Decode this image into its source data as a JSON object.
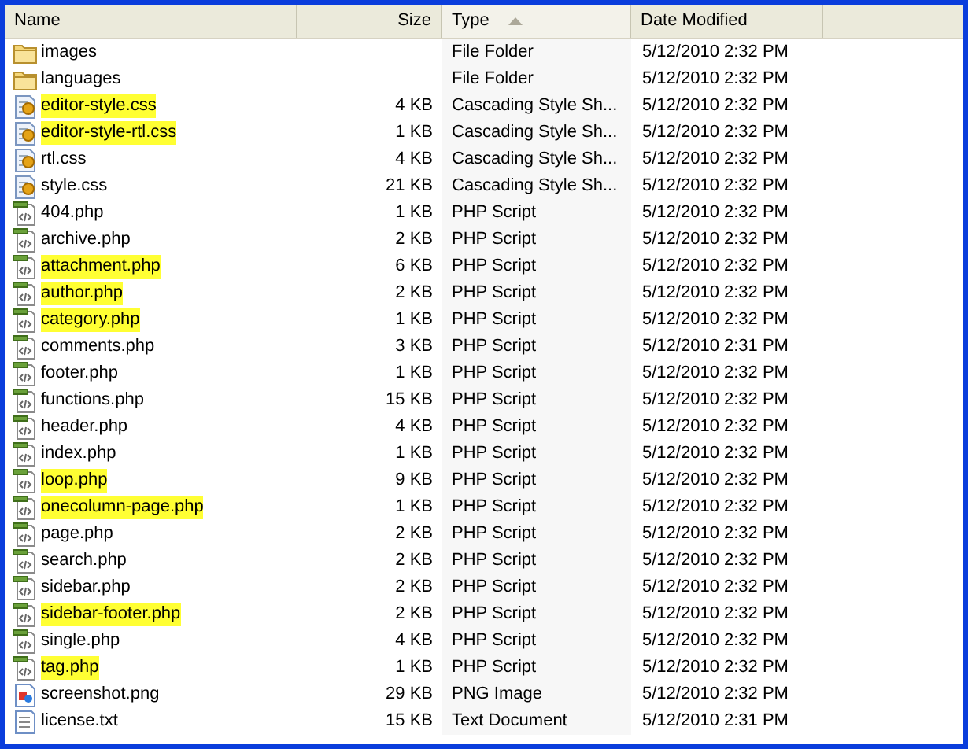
{
  "columns": [
    {
      "label": "Name",
      "sorted": false
    },
    {
      "label": "Size",
      "sorted": false
    },
    {
      "label": "Type",
      "sorted": true
    },
    {
      "label": "Date Modified",
      "sorted": false
    }
  ],
  "files": [
    {
      "kind": "folder",
      "name": "images",
      "type": "File Folder",
      "modified": "5/12/2010 2:32 PM",
      "highlighted": false
    },
    {
      "kind": "folder",
      "name": "languages",
      "type": "File Folder",
      "modified": "5/12/2010 2:32 PM",
      "highlighted": false
    },
    {
      "kind": "css",
      "name": "editor-style.css",
      "size": "4 KB",
      "type": "Cascading Style Sh...",
      "modified": "5/12/2010 2:32 PM",
      "highlighted": true
    },
    {
      "kind": "css",
      "name": "editor-style-rtl.css",
      "size": "1 KB",
      "type": "Cascading Style Sh...",
      "modified": "5/12/2010 2:32 PM",
      "highlighted": true
    },
    {
      "kind": "css",
      "name": "rtl.css",
      "size": "4 KB",
      "type": "Cascading Style Sh...",
      "modified": "5/12/2010 2:32 PM",
      "highlighted": false
    },
    {
      "kind": "css",
      "name": "style.css",
      "size": "21 KB",
      "type": "Cascading Style Sh...",
      "modified": "5/12/2010 2:32 PM",
      "highlighted": false
    },
    {
      "kind": "php",
      "name": "404.php",
      "size": "1 KB",
      "type": "PHP Script",
      "modified": "5/12/2010 2:32 PM",
      "highlighted": false
    },
    {
      "kind": "php",
      "name": "archive.php",
      "size": "2 KB",
      "type": "PHP Script",
      "modified": "5/12/2010 2:32 PM",
      "highlighted": false
    },
    {
      "kind": "php",
      "name": "attachment.php",
      "size": "6 KB",
      "type": "PHP Script",
      "modified": "5/12/2010 2:32 PM",
      "highlighted": true
    },
    {
      "kind": "php",
      "name": "author.php",
      "size": "2 KB",
      "type": "PHP Script",
      "modified": "5/12/2010 2:32 PM",
      "highlighted": true
    },
    {
      "kind": "php",
      "name": "category.php",
      "size": "1 KB",
      "type": "PHP Script",
      "modified": "5/12/2010 2:32 PM",
      "highlighted": true
    },
    {
      "kind": "php",
      "name": "comments.php",
      "size": "3 KB",
      "type": "PHP Script",
      "modified": "5/12/2010 2:31 PM",
      "highlighted": false
    },
    {
      "kind": "php",
      "name": "footer.php",
      "size": "1 KB",
      "type": "PHP Script",
      "modified": "5/12/2010 2:32 PM",
      "highlighted": false
    },
    {
      "kind": "php",
      "name": "functions.php",
      "size": "15 KB",
      "type": "PHP Script",
      "modified": "5/12/2010 2:32 PM",
      "highlighted": false
    },
    {
      "kind": "php",
      "name": "header.php",
      "size": "4 KB",
      "type": "PHP Script",
      "modified": "5/12/2010 2:32 PM",
      "highlighted": false
    },
    {
      "kind": "php",
      "name": "index.php",
      "size": "1 KB",
      "type": "PHP Script",
      "modified": "5/12/2010 2:32 PM",
      "highlighted": false
    },
    {
      "kind": "php",
      "name": "loop.php",
      "size": "9 KB",
      "type": "PHP Script",
      "modified": "5/12/2010 2:32 PM",
      "highlighted": true
    },
    {
      "kind": "php",
      "name": "onecolumn-page.php",
      "size": "1 KB",
      "type": "PHP Script",
      "modified": "5/12/2010 2:32 PM",
      "highlighted": true
    },
    {
      "kind": "php",
      "name": "page.php",
      "size": "2 KB",
      "type": "PHP Script",
      "modified": "5/12/2010 2:32 PM",
      "highlighted": false
    },
    {
      "kind": "php",
      "name": "search.php",
      "size": "2 KB",
      "type": "PHP Script",
      "modified": "5/12/2010 2:32 PM",
      "highlighted": false
    },
    {
      "kind": "php",
      "name": "sidebar.php",
      "size": "2 KB",
      "type": "PHP Script",
      "modified": "5/12/2010 2:32 PM",
      "highlighted": false
    },
    {
      "kind": "php",
      "name": "sidebar-footer.php",
      "size": "2 KB",
      "type": "PHP Script",
      "modified": "5/12/2010 2:32 PM",
      "highlighted": true
    },
    {
      "kind": "php",
      "name": "single.php",
      "size": "4 KB",
      "type": "PHP Script",
      "modified": "5/12/2010 2:32 PM",
      "highlighted": false
    },
    {
      "kind": "php",
      "name": "tag.php",
      "size": "1 KB",
      "type": "PHP Script",
      "modified": "5/12/2010 2:32 PM",
      "highlighted": true
    },
    {
      "kind": "png",
      "name": "screenshot.png",
      "size": "29 KB",
      "type": "PNG Image",
      "modified": "5/12/2010 2:32 PM",
      "highlighted": false
    },
    {
      "kind": "txt",
      "name": "license.txt",
      "size": "15 KB",
      "type": "Text Document",
      "modified": "5/12/2010 2:31 PM",
      "highlighted": false
    }
  ]
}
